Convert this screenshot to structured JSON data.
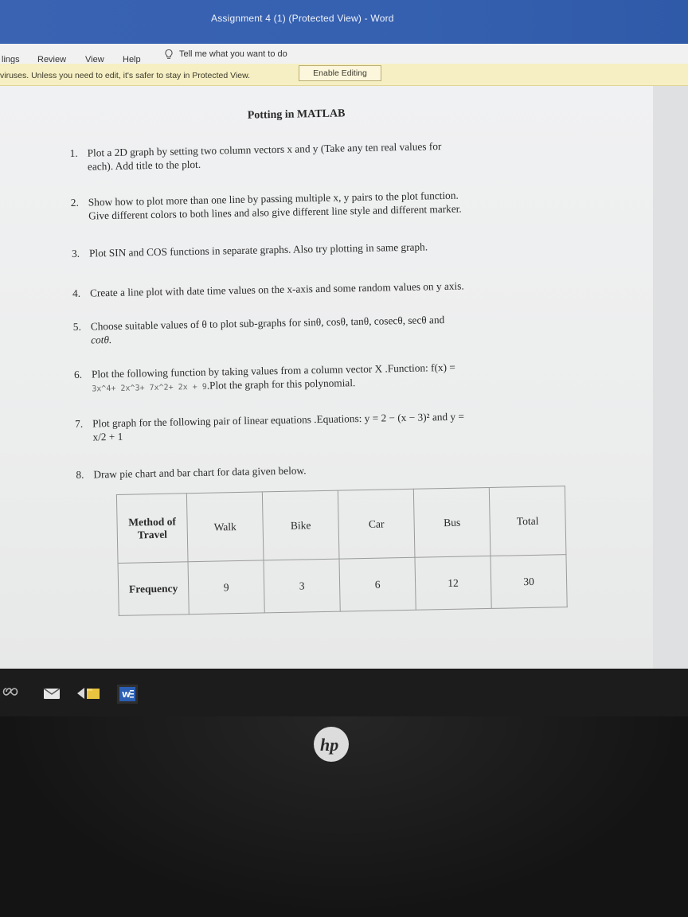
{
  "window": {
    "title": "Assignment 4 (1) (Protected View)  -  Word"
  },
  "ribbon": {
    "tabs": [
      "lings",
      "Review",
      "View",
      "Help"
    ],
    "tell_me": "Tell me what you want to do"
  },
  "protected_view": {
    "message": "viruses. Unless you need to edit, it's safer to stay in Protected View.",
    "enable_button": "Enable Editing"
  },
  "document": {
    "title": "Potting in MATLAB",
    "questions": [
      {
        "num": "1.",
        "line1": "Plot a 2D graph by setting two column vectors x and y (Take any ten real values for",
        "line2": "each). Add title to the plot."
      },
      {
        "num": "2.",
        "line1": "Show how to plot more than one line by passing multiple x, y pairs to the plot function.",
        "line2": "Give different colors to both lines and also give different line style and different marker."
      },
      {
        "num": "3.",
        "line1": "Plot SIN and COS functions in separate graphs. Also try plotting in same graph."
      },
      {
        "num": "4.",
        "line1": "Create a line plot with date time values on the x-axis and some random values on y axis."
      },
      {
        "num": "5.",
        "line1": "Choose suitable values of θ to plot sub-graphs for sinθ, cosθ, tanθ, cosecθ, secθ and",
        "line2": "cotθ."
      },
      {
        "num": "6.",
        "line1": "Plot the following function by taking values from a column vector X .Function: f(x) =",
        "line2_code": "3x^4+ 2x^3+ 7x^2+ 2x + 9",
        "line2_rest": ".Plot the graph for this polynomial."
      },
      {
        "num": "7.",
        "line1": "Plot graph for the following pair of linear equations .Equations: y = 2 − (x − 3)² and y =",
        "line2": "x/2 + 1"
      },
      {
        "num": "8.",
        "line1": "Draw pie chart and bar chart for data given below."
      }
    ],
    "table": {
      "row1": [
        "Method of Travel",
        "Walk",
        "Bike",
        "Car",
        "Bus",
        "Total"
      ],
      "row2": [
        "Frequency",
        "9",
        "3",
        "6",
        "12",
        "30"
      ]
    }
  },
  "taskbar": {
    "icons": [
      "infinity-icon",
      "mail-icon",
      "back-icon",
      "file-explorer-icon",
      "word-icon"
    ]
  },
  "brand": "hp"
}
